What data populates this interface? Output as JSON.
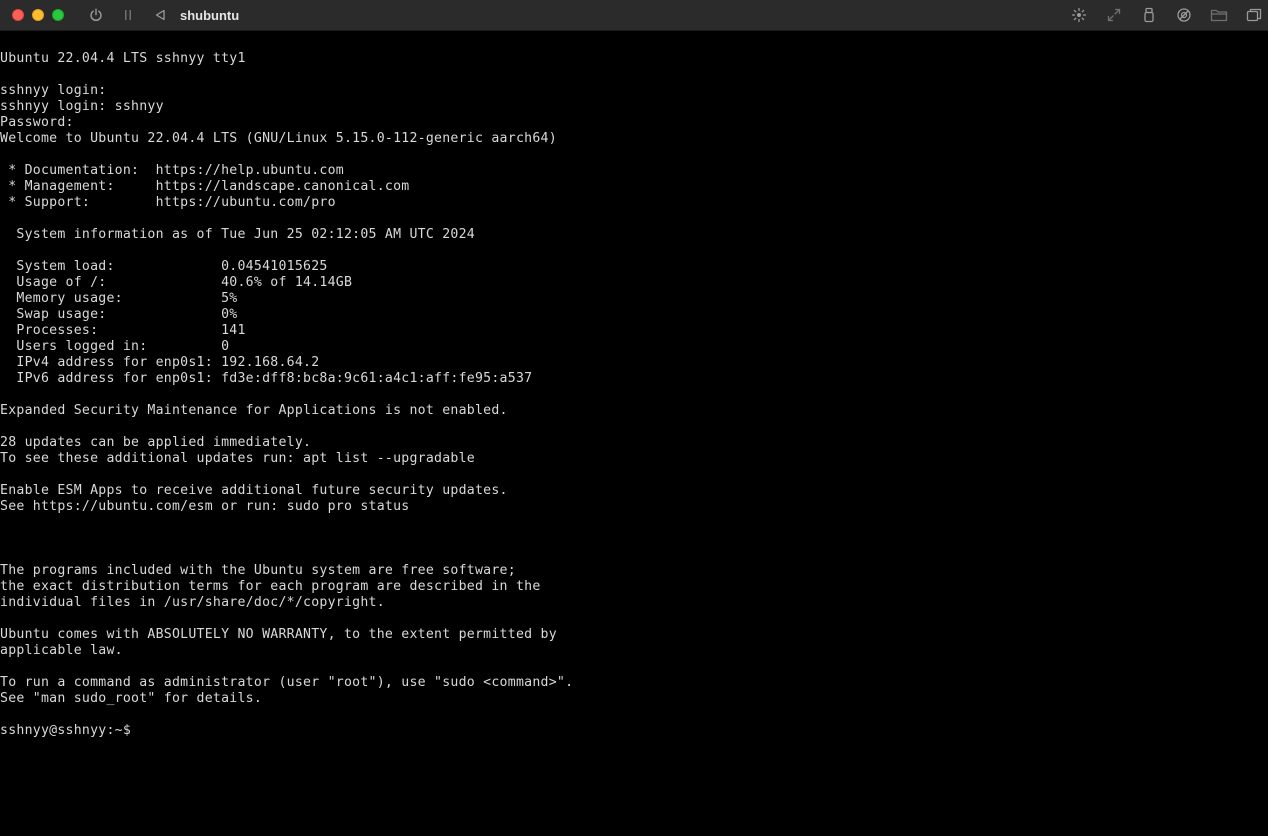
{
  "window": {
    "title": "shubuntu",
    "controls_left": [
      "power-icon",
      "pause-icon",
      "back-icon"
    ],
    "controls_right": [
      "brightness-icon",
      "fullscreen-icon",
      "usb-icon",
      "share-icon",
      "folder-icon",
      "windows-icon"
    ]
  },
  "terminal": {
    "lines": [
      "Ubuntu 22.04.4 LTS sshnyy tty1",
      "",
      "sshnyy login:",
      "sshnyy login: sshnyy",
      "Password:",
      "Welcome to Ubuntu 22.04.4 LTS (GNU/Linux 5.15.0-112-generic aarch64)",
      "",
      " * Documentation:  https://help.ubuntu.com",
      " * Management:     https://landscape.canonical.com",
      " * Support:        https://ubuntu.com/pro",
      "",
      "  System information as of Tue Jun 25 02:12:05 AM UTC 2024",
      "",
      "  System load:             0.04541015625",
      "  Usage of /:              40.6% of 14.14GB",
      "  Memory usage:            5%",
      "  Swap usage:              0%",
      "  Processes:               141",
      "  Users logged in:         0",
      "  IPv4 address for enp0s1: 192.168.64.2",
      "  IPv6 address for enp0s1: fd3e:dff8:bc8a:9c61:a4c1:aff:fe95:a537",
      "",
      "Expanded Security Maintenance for Applications is not enabled.",
      "",
      "28 updates can be applied immediately.",
      "To see these additional updates run: apt list --upgradable",
      "",
      "Enable ESM Apps to receive additional future security updates.",
      "See https://ubuntu.com/esm or run: sudo pro status",
      "",
      "",
      "",
      "The programs included with the Ubuntu system are free software;",
      "the exact distribution terms for each program are described in the",
      "individual files in /usr/share/doc/*/copyright.",
      "",
      "Ubuntu comes with ABSOLUTELY NO WARRANTY, to the extent permitted by",
      "applicable law.",
      "",
      "To run a command as administrator (user \"root\"), use \"sudo <command>\".",
      "See \"man sudo_root\" for details.",
      "",
      "sshnyy@sshnyy:~$"
    ]
  },
  "colors": {
    "terminal_bg": "#000000",
    "terminal_fg": "#d9d9d9",
    "titlebar_bg": "#2b2b2b"
  }
}
